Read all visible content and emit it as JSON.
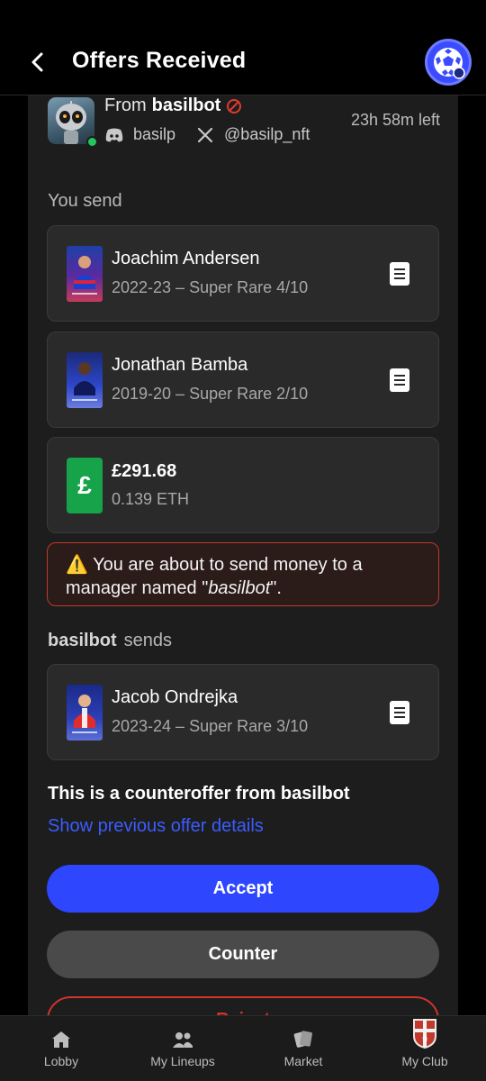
{
  "header": {
    "title": "Offers Received",
    "back_icon": "chevron-left-icon",
    "club_logo_icon": "club-ball-icon"
  },
  "offer": {
    "from_prefix": "From",
    "from_user": "basilbot",
    "blocked_icon": "blocked-icon",
    "time_left": "23h 58m left",
    "discord_handle": "basilp",
    "x_handle": "@basilp_nft"
  },
  "you_send": {
    "label": "You send",
    "cards": [
      {
        "name": "Joachim Andersen",
        "detail": "2022-23 – Super Rare 4/10"
      },
      {
        "name": "Jonathan Bamba",
        "detail": "2019-20 – Super Rare 2/10"
      }
    ],
    "money": {
      "symbol": "£",
      "amount": "£291.68",
      "eth": "0.139 ETH"
    }
  },
  "warning": {
    "icon": "⚠️",
    "text_before": "You are about to send money to a manager named \"",
    "name": "basilbot",
    "text_after": "\"."
  },
  "they_send": {
    "user": "basilbot",
    "label": "sends",
    "cards": [
      {
        "name": "Jacob Ondrejka",
        "detail": "2023-24 – Super Rare 3/10"
      }
    ]
  },
  "counter_note": "This is a counteroffer from basilbot",
  "previous_link": "Show previous offer details",
  "buttons": {
    "accept": "Accept",
    "counter": "Counter",
    "reject": "Reject"
  },
  "nav": [
    {
      "label": "Lobby",
      "icon": "home-icon"
    },
    {
      "label": "My Lineups",
      "icon": "people-icon"
    },
    {
      "label": "Market",
      "icon": "cards-icon"
    },
    {
      "label": "My Club",
      "icon": "club-crest-icon"
    }
  ],
  "colors": {
    "accent_blue": "#2f46ff",
    "link_blue": "#3b5cff",
    "danger_red": "#d0342c",
    "money_green": "#16a34a",
    "online_green": "#22c55e"
  }
}
